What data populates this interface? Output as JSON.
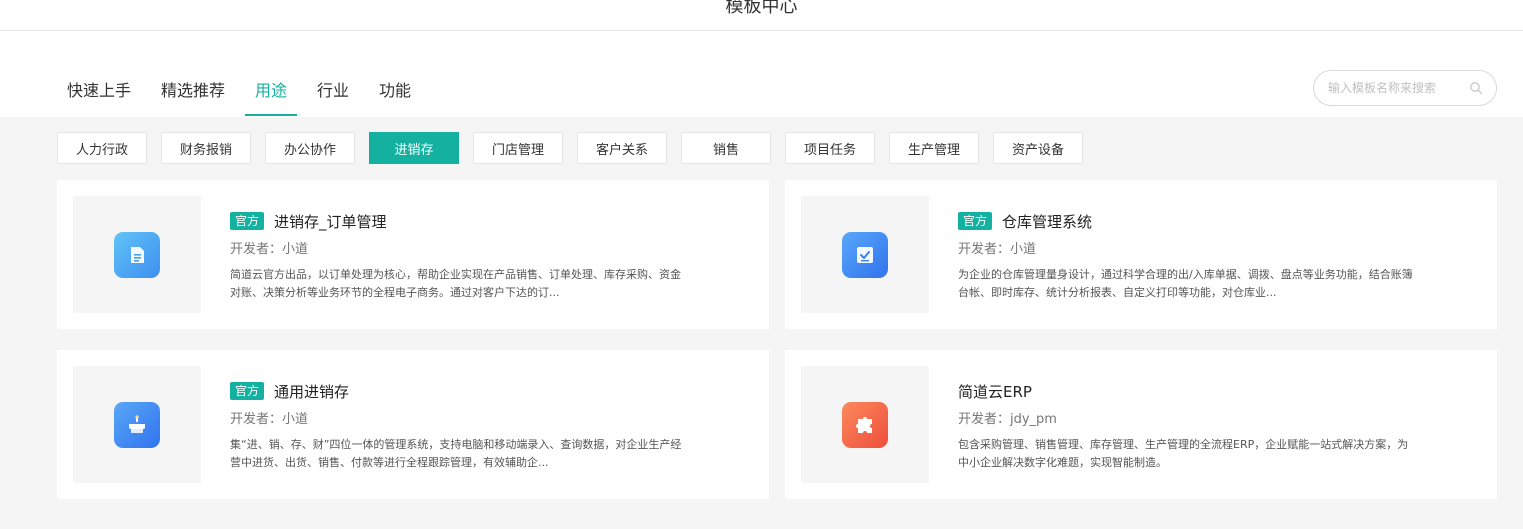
{
  "header": {
    "title": "模板中心"
  },
  "tabs": [
    {
      "label": "快速上手"
    },
    {
      "label": "精选推荐"
    },
    {
      "label": "用途"
    },
    {
      "label": "行业"
    },
    {
      "label": "功能"
    }
  ],
  "active_tab": "用途",
  "search": {
    "placeholder": "输入模板名称来搜索",
    "value": ""
  },
  "categories": [
    {
      "label": "人力行政"
    },
    {
      "label": "财务报销"
    },
    {
      "label": "办公协作"
    },
    {
      "label": "进销存"
    },
    {
      "label": "门店管理"
    },
    {
      "label": "客户关系"
    },
    {
      "label": "销售"
    },
    {
      "label": "项目任务"
    },
    {
      "label": "生产管理"
    },
    {
      "label": "资产设备"
    }
  ],
  "active_category": "进销存",
  "templates": [
    {
      "badge": "官方",
      "name": "进销存_订单管理",
      "developer": "开发者：小道",
      "description": "简道云官方出品，以订单处理为核心，帮助企业实现在产品销售、订单处理、库存采购、资金对账、决策分析等业务环节的全程电子商务。通过对客户下达的订...",
      "icon": "document-icon",
      "icon_color": "#4aa8f0"
    },
    {
      "badge": "官方",
      "name": "仓库管理系统",
      "developer": "开发者：小道",
      "description": "为企业的仓库管理量身设计，通过科学合理的出/入库单据、调拨、盘点等业务功能，结合账簿台帐、即时库存、统计分析报表、自定义打印等功能，对仓库业...",
      "icon": "checklist-icon",
      "icon_color": "#3d8df5"
    },
    {
      "badge": "官方",
      "name": "通用进销存",
      "developer": "开发者：小道",
      "description": "集“进、销、存、财”四位一体的管理系统，支持电脑和移动端录入、查询数据，对企业生产经营中进货、出货、销售、付款等进行全程跟踪管理，有效辅助企...",
      "icon": "cake-icon",
      "icon_color": "#3d8df5"
    },
    {
      "badge": "",
      "name": "简道云ERP",
      "developer": "开发者：jdy_pm",
      "description": "包含采购管理、销售管理、库存管理、生产管理的全流程ERP，企业赋能一站式解决方案，为中小企业解决数字化难题，实现智能制造。",
      "icon": "puzzle-icon",
      "icon_color": "#f26a4b"
    }
  ],
  "colors": {
    "accent": "#14b0a0",
    "background": "#f5f5f5"
  }
}
